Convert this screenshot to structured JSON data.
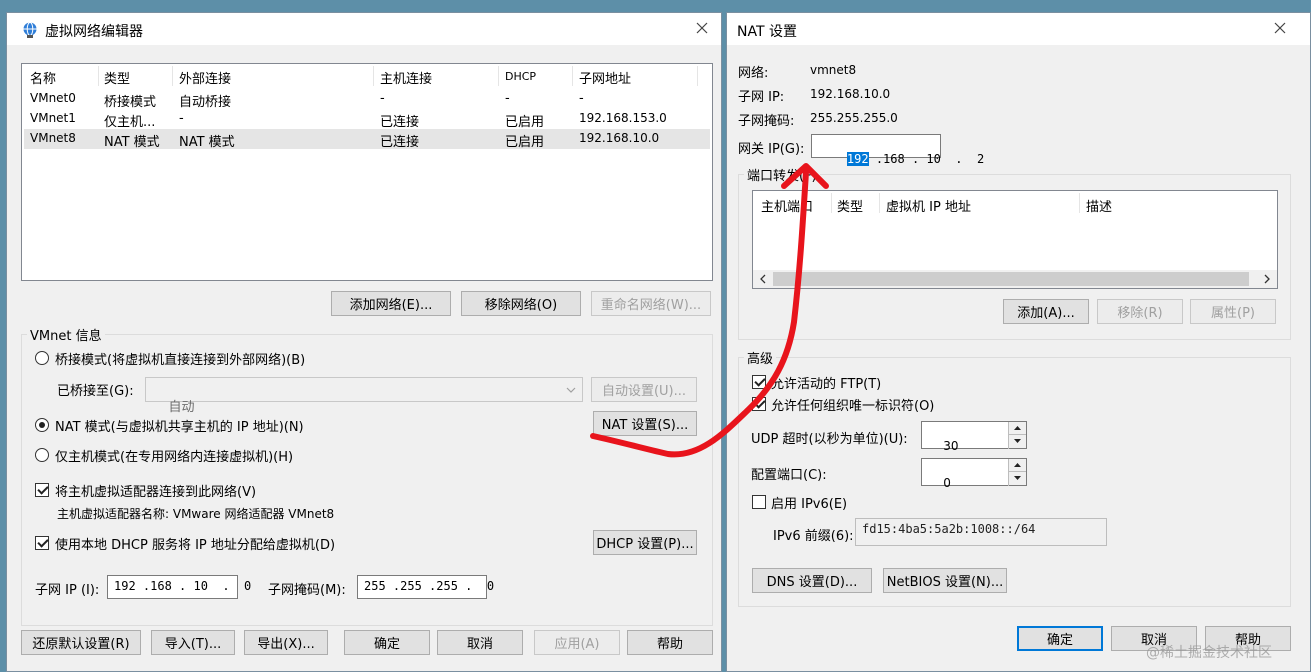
{
  "editor": {
    "title": "虚拟网络编辑器",
    "columns": [
      "名称",
      "类型",
      "外部连接",
      "主机连接",
      "DHCP",
      "子网地址"
    ],
    "rows": [
      {
        "name": "VMnet0",
        "type": "桥接模式",
        "external": "自动桥接",
        "host": "-",
        "dhcp": "-",
        "subnet": "-"
      },
      {
        "name": "VMnet1",
        "type": "仅主机...",
        "external": "-",
        "host": "已连接",
        "dhcp": "已启用",
        "subnet": "192.168.153.0"
      },
      {
        "name": "VMnet8",
        "type": "NAT 模式",
        "external": "NAT 模式",
        "host": "已连接",
        "dhcp": "已启用",
        "subnet": "192.168.10.0"
      }
    ],
    "add_network": "添加网络(E)...",
    "remove_network": "移除网络(O)",
    "rename_network": "重命名网络(W)...",
    "info_title": "VMnet 信息",
    "bridge_mode": "桥接模式(将虚拟机直接连接到外部网络)(B)",
    "bridged_to_label": "已桥接至(G):",
    "bridged_to_value": "自动",
    "auto_settings": "自动设置(U)...",
    "nat_mode": "NAT 模式(与虚拟机共享主机的 IP 地址)(N)",
    "nat_settings": "NAT 设置(S)...",
    "host_only_mode": "仅主机模式(在专用网络内连接虚拟机)(H)",
    "connect_adapter": "将主机虚拟适配器连接到此网络(V)",
    "adapter_name": "主机虚拟适配器名称: VMware 网络适配器 VMnet8",
    "use_dhcp": "使用本地 DHCP 服务将 IP 地址分配给虚拟机(D)",
    "dhcp_settings": "DHCP 设置(P)...",
    "subnet_ip_label": "子网 IP (I):",
    "subnet_ip_value": "192 .168 . 10  .  0",
    "subnet_mask_label": "子网掩码(M):",
    "subnet_mask_value": "255 .255 .255 .  0",
    "restore_defaults": "还原默认设置(R)",
    "import": "导入(T)...",
    "export": "导出(X)...",
    "ok": "确定",
    "cancel": "取消",
    "apply": "应用(A)",
    "help": "帮助"
  },
  "nat": {
    "title": "NAT 设置",
    "network_label": "网络:",
    "network_value": "vmnet8",
    "subnet_ip_label": "子网 IP:",
    "subnet_ip_value": "192.168.10.0",
    "subnet_mask_label": "子网掩码:",
    "subnet_mask_value": "255.255.255.0",
    "gateway_label": "网关 IP(G):",
    "gateway_sel": "192",
    "gateway_rest": " .168 . 10  .  2",
    "port_forward_title": "端口转发(F)",
    "pf_columns": [
      "主机端口",
      "类型",
      "虚拟机 IP 地址",
      "描述"
    ],
    "add": "添加(A)...",
    "remove": "移除(R)",
    "properties": "属性(P)",
    "advanced_title": "高级",
    "allow_ftp": "允许活动的 FTP(T)",
    "allow_oui": "允许任何组织唯一标识符(O)",
    "udp_timeout_label": "UDP 超时(以秒为单位)(U):",
    "udp_timeout_value": "30",
    "config_port_label": "配置端口(C):",
    "config_port_value": "0",
    "enable_ipv6": "启用 IPv6(E)",
    "ipv6_prefix_label": "IPv6 前缀(6):",
    "ipv6_prefix_value": "fd15:4ba5:5a2b:1008::/64",
    "dns_settings": "DNS 设置(D)...",
    "netbios_settings": "NetBIOS 设置(N)...",
    "ok": "确定",
    "cancel": "取消",
    "help": "帮助"
  },
  "watermark": "@稀土掘金技术社区",
  "colors": {
    "annotation": "#e8141c",
    "accent": "#0078d7"
  }
}
